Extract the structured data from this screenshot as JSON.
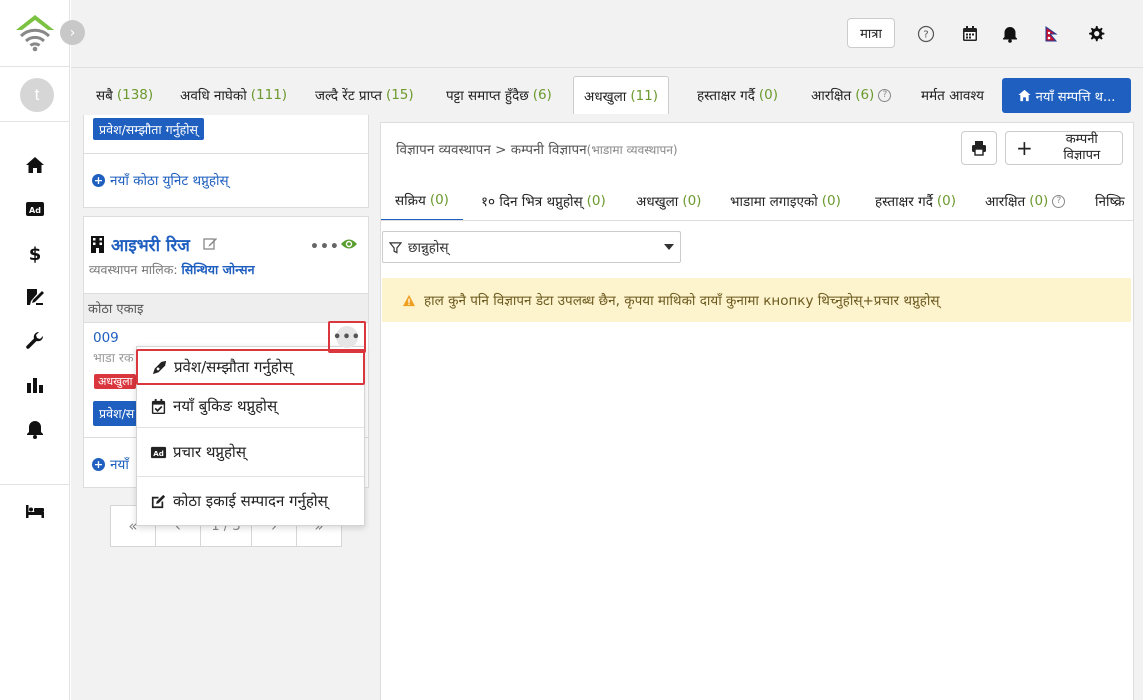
{
  "header": {
    "unit_button": "मात्रा",
    "icons": [
      "help-circle-icon",
      "calendar-icon",
      "bell-icon",
      "nepal-flag-icon",
      "gear-icon"
    ]
  },
  "rail": {
    "avatar_letter": "t",
    "icons": [
      "home-icon",
      "ad-icon",
      "dollar-icon",
      "signature-icon",
      "wrench-icon",
      "bar-chart-icon",
      "bell-icon",
      "bed-icon"
    ]
  },
  "status_tabs": [
    {
      "label": "सबै",
      "count": "(138)"
    },
    {
      "label": "अवधि नाघेको",
      "count": "(111)"
    },
    {
      "label": "जल्दै रेंट प्राप्त",
      "count": "(15)"
    },
    {
      "label": "पट्टा समाप्त हुँदैछ",
      "count": "(6)"
    },
    {
      "label": "अधखुला",
      "count": "(11)"
    },
    {
      "label": "हस्ताक्षर गर्दै",
      "count": "(0)"
    },
    {
      "label": "आरक्षित",
      "count": "(6)"
    },
    {
      "label": "मर्मत आवश्य",
      "count": ""
    }
  ],
  "new_property_button": "नयाँ सम्पत्ति थ...",
  "left_panel": {
    "top_card": {
      "agreement_button": "प्रवेश/सम्झौता गर्नुहोस्",
      "add_unit_link": "नयाँ कोठा युनिट थप्नुहोस्"
    },
    "property": {
      "name": "आइभरी रिज",
      "owner_label": "व्यवस्थापन मालिक:",
      "owner_name": "सिन्थिया जोन्सन",
      "room_unit_header": "कोठा एकाइ",
      "unit_number": "009",
      "unit_sub": "भाडा रक",
      "vacant_badge": "अधखुला",
      "agreement_button": "प्रवेश/स",
      "add_unit_link": "नयाँ"
    },
    "pagination": {
      "first": "«",
      "prev": "‹",
      "page": "1 / 3",
      "next": "›",
      "last": "»"
    }
  },
  "menu": {
    "items": [
      {
        "label": "प्रवेश/सम्झौता गर्नुहोस्",
        "icon": "pen-nib-icon"
      },
      {
        "label": "नयाँ बुकिङ थप्नुहोस्",
        "icon": "calendar-check-icon"
      },
      {
        "label": "प्रचार थप्नुहोस्",
        "icon": "ad-icon"
      },
      {
        "label": "कोठा इकाई सम्पादन गर्नुहोस्",
        "icon": "edit-icon"
      }
    ]
  },
  "right_panel": {
    "breadcrumb": "विज्ञापन व्यवस्थापन > कम्पनी विज्ञापन",
    "breadcrumb_sub": "(भाडामा व्यवस्थापन)",
    "company_ad_button": "कम्पनी विज्ञापन",
    "tabs": [
      {
        "label": "सक्रिय",
        "count": "(0)"
      },
      {
        "label": "१० दिन भित्र थप्नुहोस्",
        "count": "(0)"
      },
      {
        "label": "अधखुला",
        "count": "(0)"
      },
      {
        "label": "भाडामा लगाइएको",
        "count": "(0)"
      },
      {
        "label": "हस्ताक्षर गर्दै",
        "count": "(0)"
      },
      {
        "label": "आरक्षित",
        "count": "(0)"
      },
      {
        "label": "निष्क्रि",
        "count": ""
      }
    ],
    "filter_placeholder": "छान्नुहोस्",
    "notice": "हाल कुनै पनि विज्ञापन डेटा उपलब्ध छैन, कृपया माथिको दायाँ कुनामा кнопку थिच्नुहोस्+प्रचार थप्नुहोस्"
  }
}
